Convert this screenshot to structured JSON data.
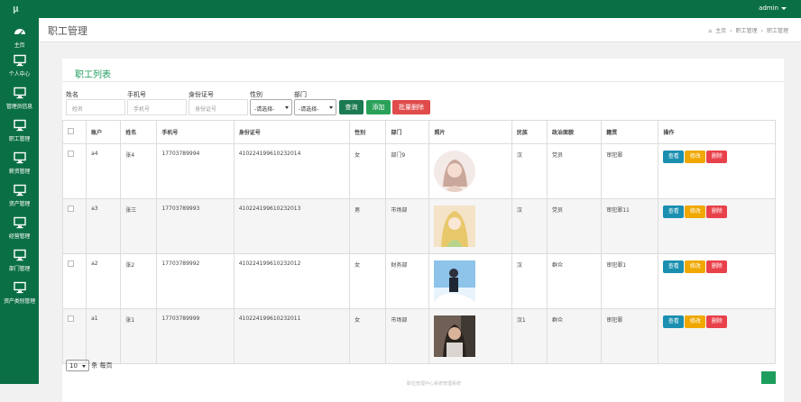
{
  "app": {
    "logo": "μ",
    "user": "admin"
  },
  "sidebar": {
    "items": [
      {
        "label": "主页",
        "icon": "dashboard-icon"
      },
      {
        "label": "个人中心",
        "icon": "monitor-icon"
      },
      {
        "label": "管理员信息",
        "icon": "monitor-icon"
      },
      {
        "label": "职工管理",
        "icon": "monitor-icon"
      },
      {
        "label": "薪资管理",
        "icon": "monitor-icon"
      },
      {
        "label": "资产管理",
        "icon": "monitor-icon"
      },
      {
        "label": "经营管理",
        "icon": "monitor-icon"
      },
      {
        "label": "部门管理",
        "icon": "monitor-icon"
      },
      {
        "label": "资产类别管理",
        "icon": "monitor-icon"
      }
    ]
  },
  "header": {
    "title": "职工管理",
    "breadcrumb": [
      "主页",
      "职工管理",
      "职工管理"
    ]
  },
  "panel": {
    "title": "职工列表"
  },
  "search": {
    "name_label": "姓名",
    "name_ph": "姓名",
    "phone_label": "手机号",
    "phone_ph": "手机号",
    "id_label": "身份证号",
    "id_ph": "身份证号",
    "gender_label": "性别",
    "gender_value": "-请选择-",
    "dept_label": "部门",
    "dept_value": "-请选择-",
    "query": "查询",
    "add": "添加",
    "batch_delete": "批量删除"
  },
  "table": {
    "headers": [
      "账户",
      "姓名",
      "手机号",
      "身份证号",
      "性别",
      "部门",
      "照片",
      "民族",
      "政治面貌",
      "籍贯",
      "操作"
    ],
    "actions": {
      "view": "查看",
      "edit": "修改",
      "delete": "删除"
    },
    "rows": [
      {
        "account": "a4",
        "name": "张4",
        "phone": "17703789994",
        "idno": "410224199610232014",
        "gender": "女",
        "dept": "部门9",
        "ethnic": "汉",
        "political": "党员",
        "origin": "审犯罪"
      },
      {
        "account": "a3",
        "name": "张三",
        "phone": "17703789993",
        "idno": "410224199610232013",
        "gender": "男",
        "dept": "市场部",
        "ethnic": "汉",
        "political": "党员",
        "origin": "审犯罪11"
      },
      {
        "account": "a2",
        "name": "张2",
        "phone": "17703789992",
        "idno": "410224199610232012",
        "gender": "女",
        "dept": "财务部",
        "ethnic": "汉",
        "political": "群众",
        "origin": "审犯罪1"
      },
      {
        "account": "a1",
        "name": "张1",
        "phone": "17703789999",
        "idno": "410224199610232011",
        "gender": "女",
        "dept": "市场部",
        "ethnic": "汉1",
        "political": "群众",
        "origin": "审犯罪"
      }
    ]
  },
  "pager": {
    "per_page": "10",
    "suffix": "条 每页"
  },
  "footer": {
    "text": "职位管理中心系统管理系统"
  }
}
